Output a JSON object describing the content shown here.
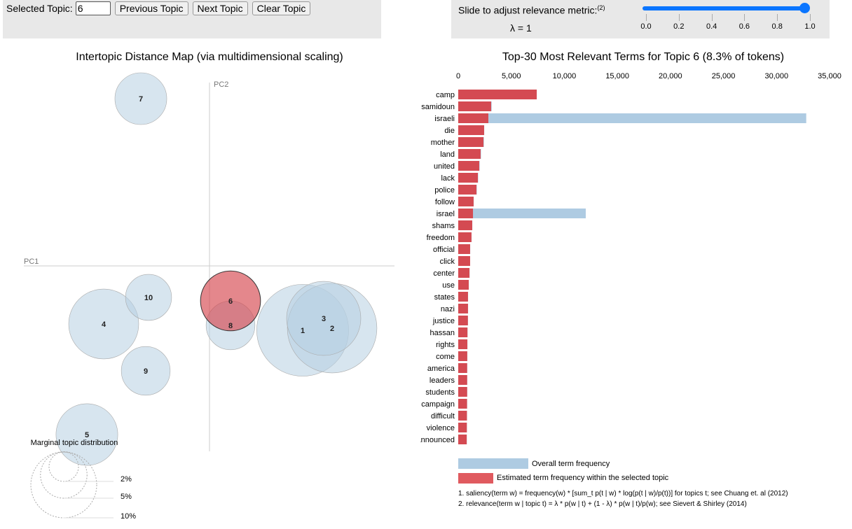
{
  "controls": {
    "selected_topic_label": "Selected Topic:",
    "selected_topic_value": "6",
    "prev_label": "Previous Topic",
    "next_label": "Next Topic",
    "clear_label": "Clear Topic",
    "slider_label": "Slide to adjust relevance metric:",
    "slider_footnote": "(2)",
    "lambda_text": "λ = 1",
    "lambda_value": 1,
    "slider_ticks": [
      "0.0",
      "0.2",
      "0.4",
      "0.6",
      "0.8",
      "1.0"
    ]
  },
  "colors": {
    "selected": "#d6474f",
    "topic": "#b7cfe2",
    "overall": "#aecbe2",
    "estimated": "#d44a52"
  },
  "chart_data": [
    {
      "type": "scatter",
      "title": "Intertopic Distance Map (via multidimensional scaling)",
      "xlabel": "PC1",
      "ylabel": "PC2",
      "selected_topic": 6,
      "topics": [
        {
          "id": "1",
          "marginal_pct": 19.5
        },
        {
          "id": "2",
          "marginal_pct": 18.5
        },
        {
          "id": "3",
          "marginal_pct": 12.7
        },
        {
          "id": "4",
          "marginal_pct": 11.3
        },
        {
          "id": "5",
          "marginal_pct": 8.8
        },
        {
          "id": "6",
          "marginal_pct": 8.3
        },
        {
          "id": "7",
          "marginal_pct": 6.2
        },
        {
          "id": "8",
          "marginal_pct": 5.5
        },
        {
          "id": "9",
          "marginal_pct": 5.5
        },
        {
          "id": "10",
          "marginal_pct": 4.9
        }
      ],
      "size_legend": {
        "title": "Marginal topic distribution",
        "labels": [
          "2%",
          "5%",
          "10%"
        ],
        "values": [
          2,
          5,
          10
        ]
      }
    },
    {
      "type": "bar",
      "title": "Top-30 Most Relevant Terms for Topic 6 (8.3% of tokens)",
      "xlim": [
        0,
        35000
      ],
      "x_ticks": [
        "0",
        "5,000",
        "10,000",
        "15,000",
        "20,000",
        "25,000",
        "30,000",
        "35,000"
      ],
      "x_tick_values": [
        0,
        5000,
        10000,
        15000,
        20000,
        25000,
        30000,
        35000
      ],
      "legend": [
        "Overall term frequency",
        "Estimated term frequency within the selected topic"
      ],
      "terms": [
        "camp",
        "samidoun",
        "israeli",
        "die",
        "mother",
        "land",
        "united",
        "lack",
        "police",
        "follow",
        "israel",
        "shams",
        "freedom",
        "official",
        "click",
        "center",
        "use",
        "states",
        "nazi",
        "justice",
        "hassan",
        "rights",
        "come",
        "america",
        "leaders",
        "students",
        "campaign",
        "difficult",
        "violence",
        "announced"
      ],
      "series": [
        {
          "name": "Overall term frequency",
          "values": [
            7400,
            3150,
            32800,
            2450,
            2420,
            2150,
            2020,
            1880,
            1750,
            1460,
            12020,
            1330,
            1260,
            1130,
            1120,
            1070,
            1000,
            930,
            930,
            920,
            880,
            870,
            860,
            850,
            850,
            850,
            840,
            830,
            820,
            810
          ]
        },
        {
          "name": "Estimated term frequency within the selected topic",
          "values": [
            7400,
            3100,
            2840,
            2440,
            2380,
            2110,
            1980,
            1850,
            1720,
            1450,
            1390,
            1320,
            1250,
            1120,
            1120,
            1060,
            990,
            920,
            920,
            910,
            870,
            860,
            850,
            840,
            840,
            840,
            830,
            820,
            810,
            800
          ]
        }
      ],
      "footnotes": [
        "1. saliency(term w) = frequency(w) * [sum_t p(t | w) * log(p(t | w)/p(t))] for topics t; see Chuang et. al (2012)",
        "2. relevance(term w | topic t) = λ * p(w | t) + (1 - λ) * p(w | t)/p(w); see Sievert & Shirley (2014)"
      ]
    }
  ]
}
